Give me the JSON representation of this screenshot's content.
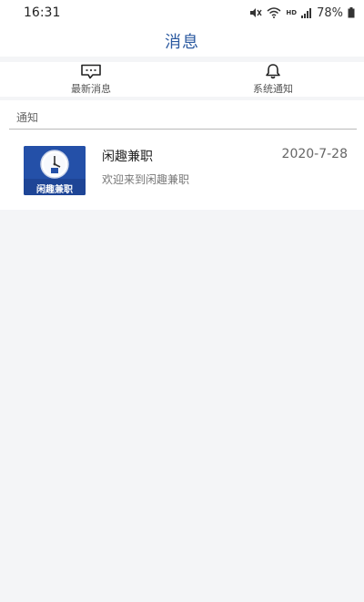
{
  "status_bar": {
    "time": "16:31",
    "battery_text": "78%",
    "signal_label": "HD",
    "icons": [
      "mute-icon",
      "wifi-icon",
      "signal-icon",
      "battery-icon"
    ]
  },
  "header": {
    "title": "消息"
  },
  "tabs": [
    {
      "label": "最新消息",
      "icon": "chat-bubble-icon"
    },
    {
      "label": "系统通知",
      "icon": "bell-icon"
    }
  ],
  "notifications": {
    "section_title": "通知",
    "items": [
      {
        "title": "闲趣兼职",
        "date": "2020-7-28",
        "preview": "欢迎来到闲趣兼职",
        "icon_caption": "闲趣兼职"
      }
    ]
  },
  "colors": {
    "accent": "#2c5aa0",
    "app_icon_bg": "#2450a8",
    "background": "#f4f5f7"
  }
}
